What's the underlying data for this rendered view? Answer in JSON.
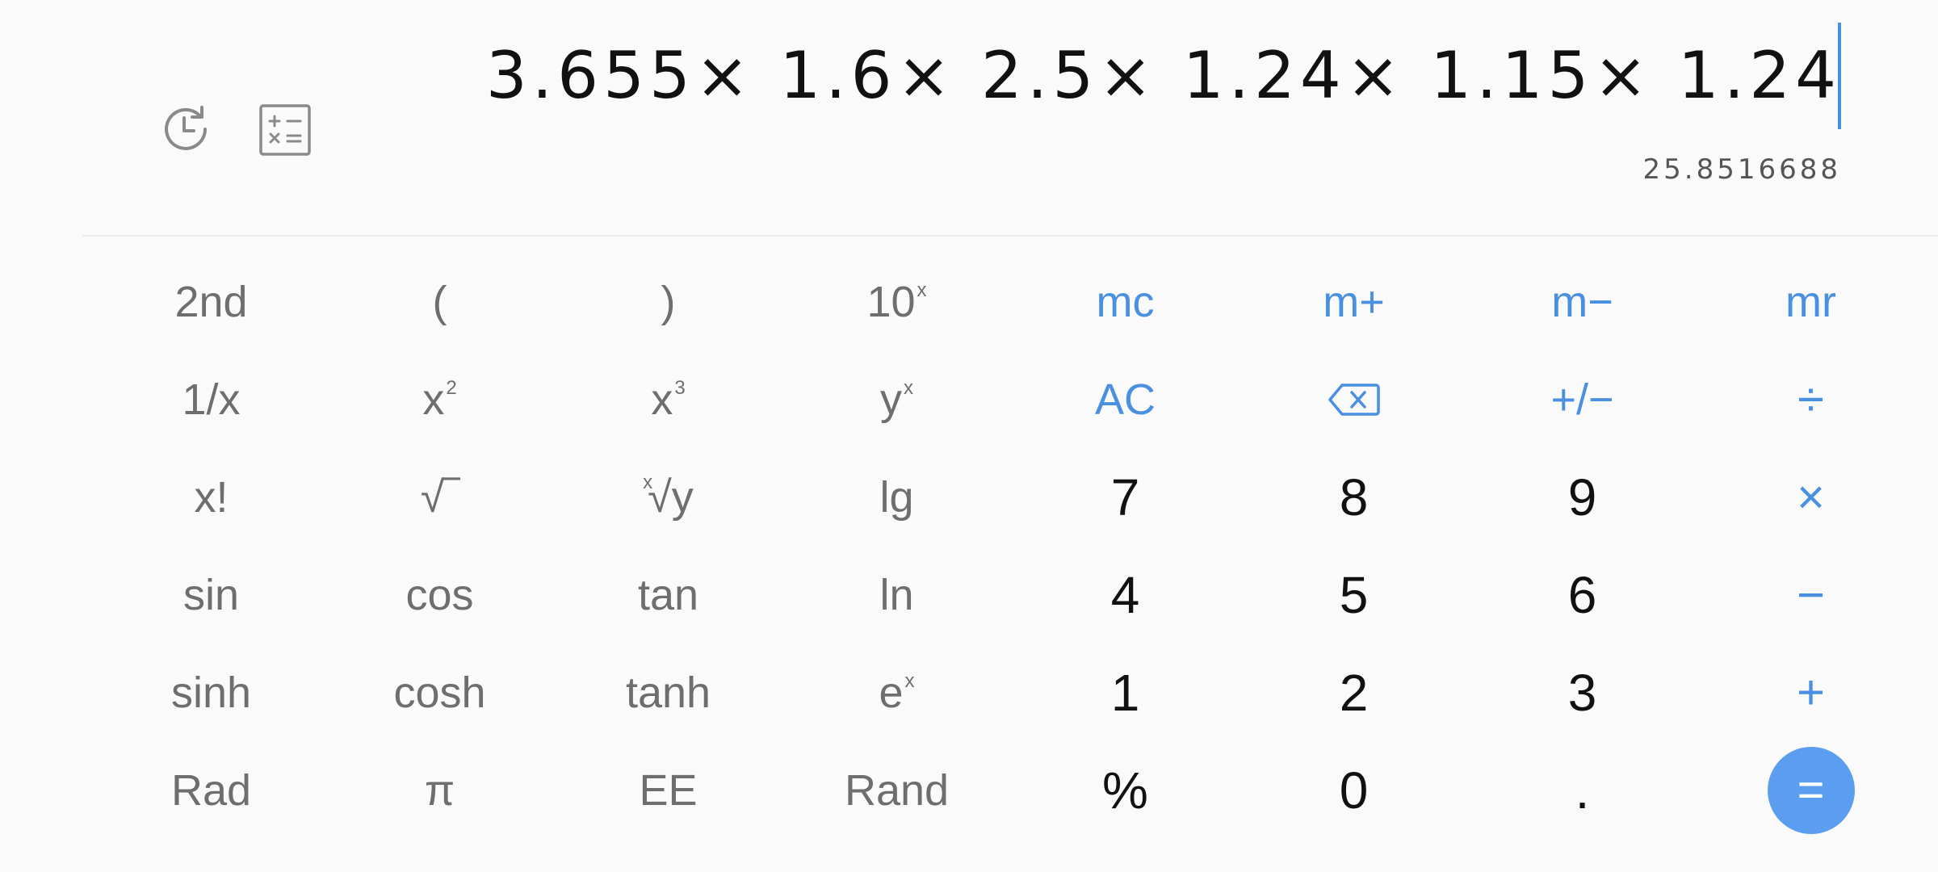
{
  "display": {
    "expression": "3.655× 1.6× 2.5× 1.24× 1.15× 1.24",
    "result": "25.8516688"
  },
  "top_icons": {
    "history": "history-icon",
    "unit_converter": "calculator-icon"
  },
  "keys": {
    "second": "2nd",
    "paren_open": "(",
    "paren_close": ")",
    "ten_pow_base": "10",
    "ten_pow_sup": "x",
    "mc": "mc",
    "m_plus": "m+",
    "m_minus": "m−",
    "mr": "mr",
    "reciprocal": "1/x",
    "square_base": "x",
    "square_sup": "2",
    "cube_base": "x",
    "cube_sup": "3",
    "ypow_base": "y",
    "ypow_sup": "x",
    "ac": "AC",
    "plus_minus": "+/−",
    "divide": "÷",
    "factorial": "x!",
    "sqrt": "√‾",
    "root_pre": "x",
    "root_base": "√y",
    "lg": "lg",
    "seven": "7",
    "eight": "8",
    "nine": "9",
    "multiply": "×",
    "sin": "sin",
    "cos": "cos",
    "tan": "tan",
    "ln": "ln",
    "four": "4",
    "five": "5",
    "six": "6",
    "minus": "−",
    "sinh": "sinh",
    "cosh": "cosh",
    "tanh": "tanh",
    "exp_base": "e",
    "exp_sup": "x",
    "one": "1",
    "two": "2",
    "three": "3",
    "plus": "+",
    "rad": "Rad",
    "pi": "π",
    "ee": "EE",
    "rand": "Rand",
    "percent": "%",
    "zero": "0",
    "dot": ".",
    "equals": "="
  },
  "colors": {
    "accent": "#4a90e2",
    "equals_bg": "#5b9ef0",
    "function_text": "#6e6e6e",
    "number_text": "#111111"
  }
}
